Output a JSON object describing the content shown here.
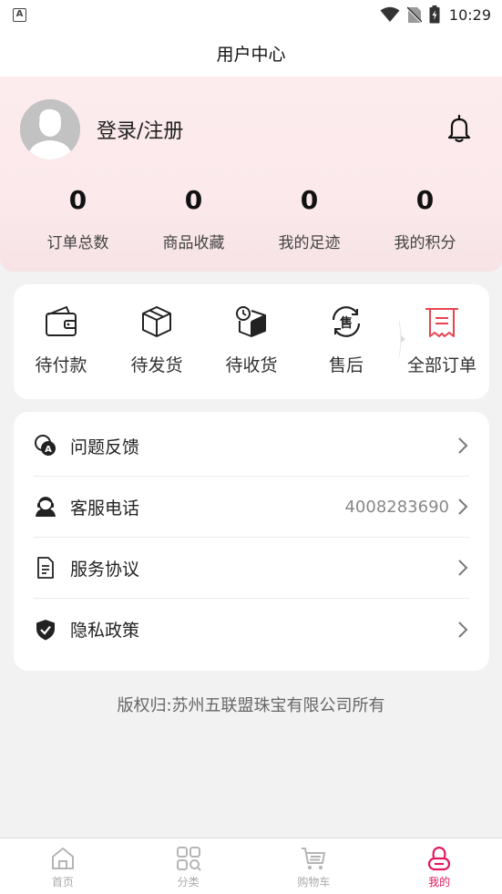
{
  "status_bar": {
    "badge": "A",
    "time": "10:29",
    "icons": [
      "wifi-icon",
      "no-sim-icon",
      "battery-charging-icon"
    ]
  },
  "header": {
    "title": "用户中心"
  },
  "profile": {
    "login_label": "登录/注册",
    "avatar_icon": "default-avatar-icon",
    "bell_icon": "bell-icon",
    "stats": [
      {
        "value": "0",
        "label": "订单总数"
      },
      {
        "value": "0",
        "label": "商品收藏"
      },
      {
        "value": "0",
        "label": "我的足迹"
      },
      {
        "value": "0",
        "label": "我的积分"
      }
    ]
  },
  "orders": {
    "items": [
      {
        "label": "待付款",
        "icon": "wallet-icon"
      },
      {
        "label": "待发货",
        "icon": "package-icon"
      },
      {
        "label": "待收货",
        "icon": "delivery-box-icon"
      },
      {
        "label": "售后",
        "icon": "after-sales-icon"
      },
      {
        "label": "全部订单",
        "icon": "receipt-icon"
      }
    ],
    "accent_color": "#e8434f"
  },
  "menu": {
    "items": [
      {
        "label": "问题反馈",
        "value": "",
        "icon": "feedback-icon"
      },
      {
        "label": "客服电话",
        "value": "4008283690",
        "icon": "customer-service-icon"
      },
      {
        "label": "服务协议",
        "value": "",
        "icon": "document-icon"
      },
      {
        "label": "隐私政策",
        "value": "",
        "icon": "shield-check-icon"
      }
    ]
  },
  "footer": {
    "copyright": "版权归:苏州五联盟珠宝有限公司所有"
  },
  "tab_bar": {
    "tabs": [
      {
        "label": "首页",
        "icon": "home-icon",
        "active": false
      },
      {
        "label": "分类",
        "icon": "category-icon",
        "active": false
      },
      {
        "label": "购物车",
        "icon": "cart-icon",
        "active": false
      },
      {
        "label": "我的",
        "icon": "profile-icon",
        "active": true
      }
    ],
    "active_color": "#e2185b",
    "inactive_color": "#aaaaaa"
  }
}
